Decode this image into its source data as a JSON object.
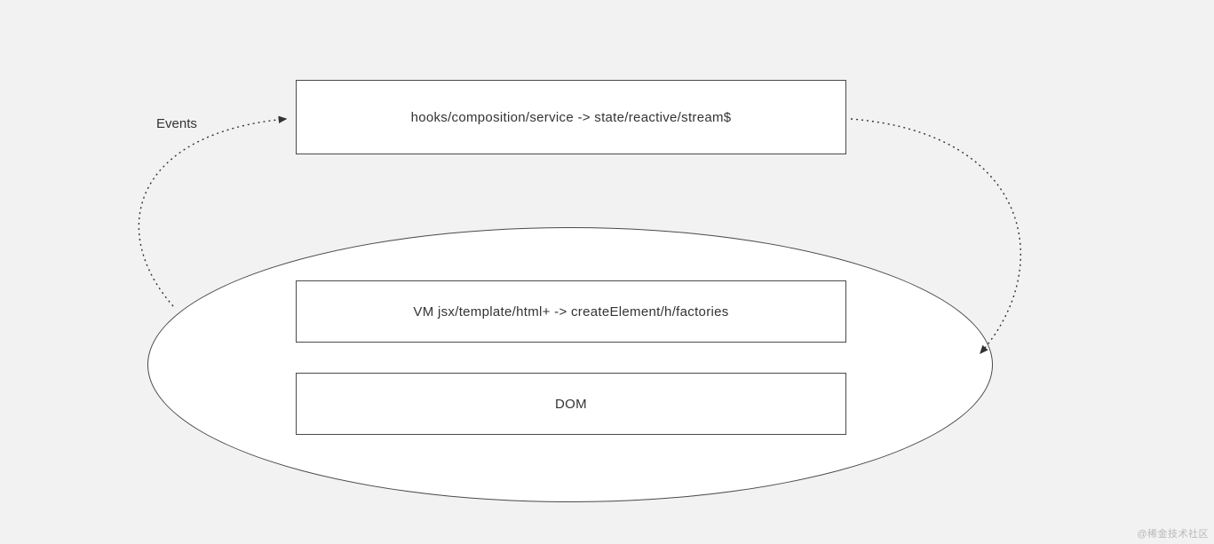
{
  "boxes": {
    "top": {
      "label": "hooks/composition/service -> state/reactive/stream$"
    },
    "vm": {
      "label": "VM    jsx/template/html+ ->  createElement/h/factories"
    },
    "dom": {
      "label": "DOM"
    }
  },
  "labels": {
    "events": "Events"
  },
  "watermark": "@稀金技术社区"
}
